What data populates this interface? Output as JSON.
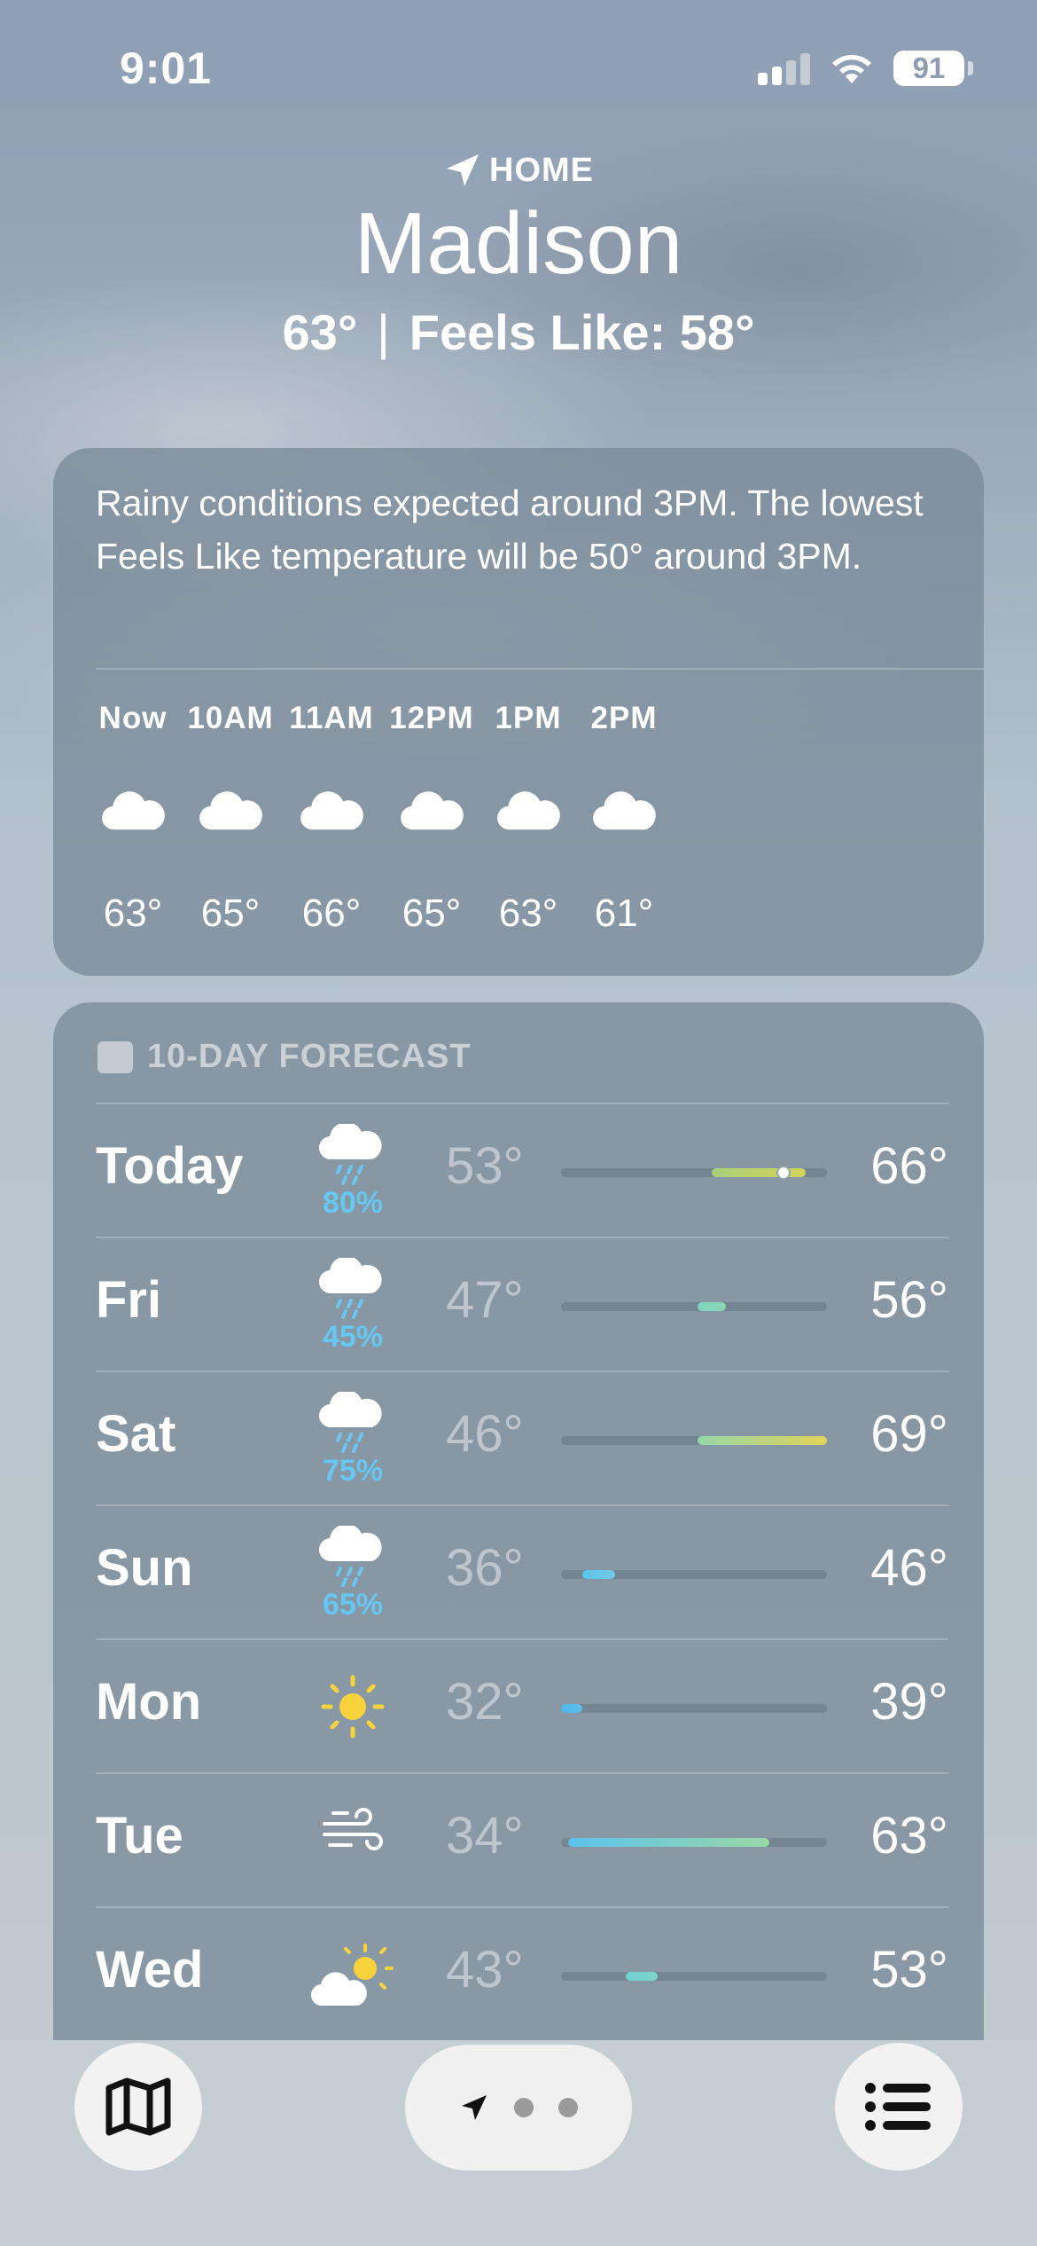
{
  "status_bar": {
    "time": "9:01",
    "battery": "91"
  },
  "location": {
    "label": "HOME",
    "city": "Madison",
    "current_temp": "63°",
    "feels_like": "Feels Like: 58°"
  },
  "hourly": {
    "summary": "Rainy conditions expected around 3PM. The lowest Feels Like temperature will be 50° around 3PM.",
    "hours": [
      {
        "label": "Now",
        "icon": "cloud-icon",
        "temp": "63°"
      },
      {
        "label": "10AM",
        "icon": "cloud-icon",
        "temp": "65°"
      },
      {
        "label": "11AM",
        "icon": "cloud-icon",
        "temp": "66°"
      },
      {
        "label": "12PM",
        "icon": "cloud-icon",
        "temp": "65°"
      },
      {
        "label": "1PM",
        "icon": "cloud-icon",
        "temp": "63°"
      },
      {
        "label": "2PM",
        "icon": "cloud-icon",
        "temp": "61°"
      }
    ]
  },
  "forecast": {
    "title": "10-DAY FORECAST",
    "range_min": 32,
    "range_max": 69,
    "days": [
      {
        "day": "Today",
        "icon": "rain-cloud-icon",
        "precip": "80%",
        "low": "53°",
        "high": "66°",
        "low_val": 53,
        "high_val": 66,
        "current_val": 63,
        "color_from": "#a8cf7a",
        "color_to": "#d4d45a"
      },
      {
        "day": "Fri",
        "icon": "rain-cloud-icon",
        "precip": "45%",
        "low": "47°",
        "high": "56°",
        "low_val": 51,
        "high_val": 55,
        "color_from": "#7ed3c0",
        "color_to": "#8ed6b4"
      },
      {
        "day": "Sat",
        "icon": "rain-cloud-icon",
        "precip": "75%",
        "low": "46°",
        "high": "69°",
        "low_val": 51,
        "high_val": 69,
        "color_from": "#98d6a8",
        "color_to": "#e2d25a"
      },
      {
        "day": "Sun",
        "icon": "rain-cloud-icon",
        "precip": "65%",
        "low": "36°",
        "high": "46°",
        "low_val": 35,
        "high_val": 39.5,
        "color_from": "#5ec4ea",
        "color_to": "#6fcbe6"
      },
      {
        "day": "Mon",
        "icon": "sun-icon",
        "precip": "",
        "low": "32°",
        "high": "39°",
        "low_val": 32,
        "high_val": 35,
        "color_from": "#4fb6ee",
        "color_to": "#5fbfea"
      },
      {
        "day": "Tue",
        "icon": "wind-icon",
        "precip": "",
        "low": "34°",
        "high": "63°",
        "low_val": 33,
        "high_val": 61,
        "color_from": "#5cc3ee",
        "color_to": "#9ad8a6"
      },
      {
        "day": "Wed",
        "icon": "partly-sunny-icon",
        "precip": "",
        "low": "43°",
        "high": "53°",
        "low_val": 41,
        "high_val": 45.5,
        "color_from": "#6fd0d2",
        "color_to": "#7fd5c8"
      }
    ]
  },
  "toolbar": {
    "map": "map-icon",
    "location": "location-arrow-icon",
    "list": "list-icon"
  }
}
